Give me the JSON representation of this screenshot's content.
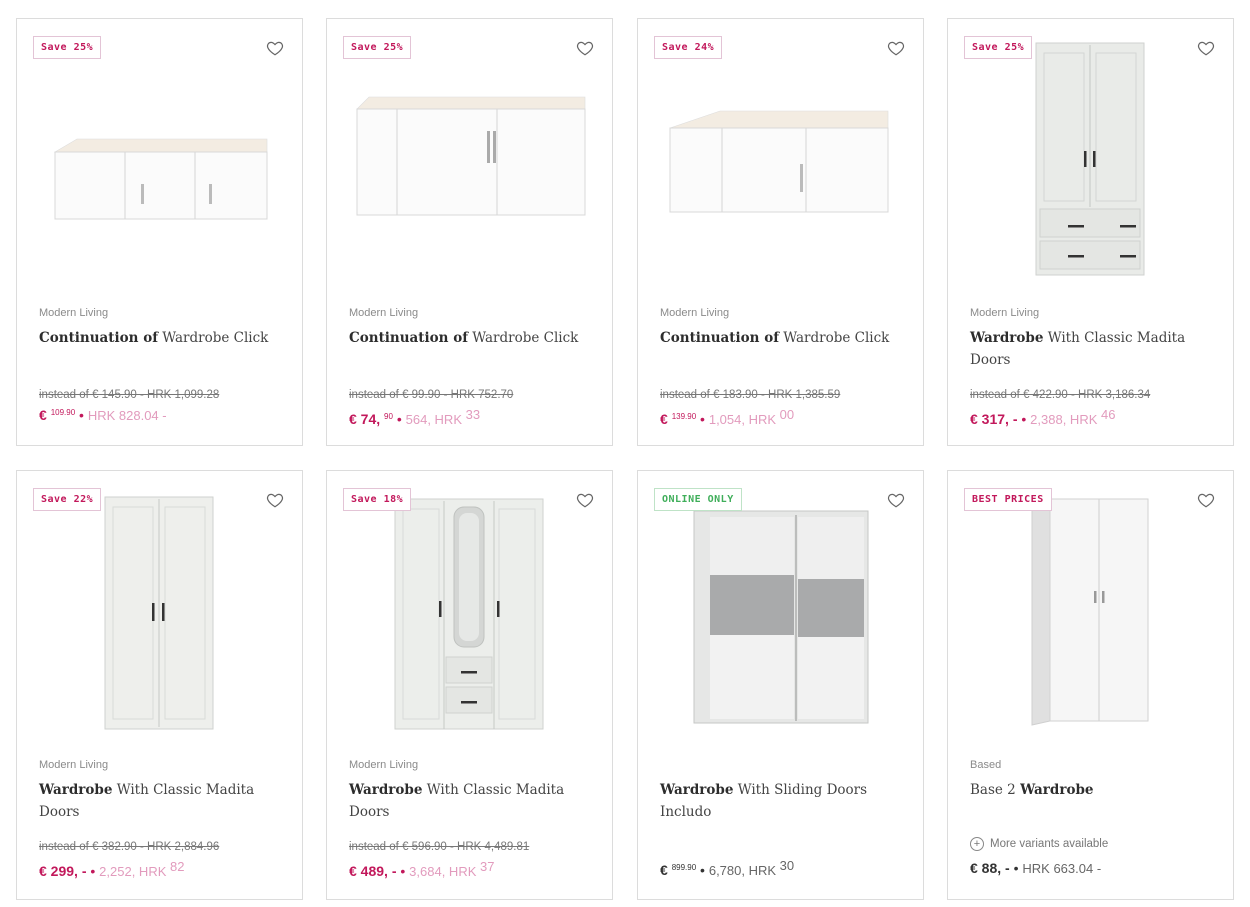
{
  "products": [
    {
      "badge": "Save 25%",
      "brand": "Modern Living",
      "title_bold": "Continuation of",
      "title_rest": " Wardrobe Click",
      "old_price": "instead of € 145.90 - HRK 1,099.28",
      "price_main": "€ ",
      "price_sup": "109.90",
      "price_sep": " • ",
      "price_conv": "HRK 828.04 -",
      "price_conv_sup": ""
    },
    {
      "badge": "Save 25%",
      "brand": "Modern Living",
      "title_bold": "Continuation of",
      "title_rest": " Wardrobe Click",
      "old_price": "instead of € 99.90 - HRK 752.70",
      "price_main": "€ 74, ",
      "price_sup": "90",
      "price_sep": " • ",
      "price_conv": "564, HRK ",
      "price_conv_sup": "33"
    },
    {
      "badge": "Save 24%",
      "brand": "Modern Living",
      "title_bold": "Continuation of",
      "title_rest": " Wardrobe Click",
      "old_price": "instead of € 183.90 - HRK 1,385.59",
      "price_main": "€ ",
      "price_sup": "139.90",
      "price_sep": " • ",
      "price_conv": "1,054, HRK ",
      "price_conv_sup": "00"
    },
    {
      "badge": "Save 25%",
      "brand": "Modern Living",
      "title_bold": "Wardrobe",
      "title_rest": " With Classic Madita Doors",
      "old_price": "instead of € 422.90 - HRK 3,186.34",
      "price_main": "€ 317, - ",
      "price_sup": "",
      "price_sep": "• ",
      "price_conv": "2,388, HRK ",
      "price_conv_sup": "46"
    },
    {
      "badge": "Save 22%",
      "brand": "Modern Living",
      "title_bold": "Wardrobe",
      "title_rest": " With Classic Madita Doors",
      "old_price": "instead of € 382.90 - HRK 2,884.96",
      "price_main": "€ 299, - ",
      "price_sup": "",
      "price_sep": "• ",
      "price_conv": "2,252, HRK ",
      "price_conv_sup": "82"
    },
    {
      "badge": "Save 18%",
      "brand": "Modern Living",
      "title_bold": "Wardrobe",
      "title_rest": " With Classic Madita Doors",
      "old_price": "instead of € 596.90 - HRK 4,489.81",
      "price_main": "€ 489, - ",
      "price_sup": "",
      "price_sep": "• ",
      "price_conv": "3,684, HRK ",
      "price_conv_sup": "37"
    },
    {
      "badge": "ONLINE ONLY",
      "brand": "",
      "title_bold": "Wardrobe",
      "title_rest": " With Sliding Doors Includo",
      "old_price": "",
      "price_main": "€ ",
      "price_sup": "899.90",
      "price_sep": " • ",
      "price_conv": "6,780, HRK ",
      "price_conv_sup": "30"
    },
    {
      "badge": "BEST PRICES",
      "brand": "Based",
      "title_plain": "Base 2 ",
      "title_bold": "Wardrobe",
      "variants": "More variants available",
      "price_main": "€ 88, - ",
      "price_sup": "",
      "price_sep": "• ",
      "price_conv": "HRK 663.04 -",
      "price_conv_sup": ""
    }
  ],
  "colors": {
    "accent": "#c2185b",
    "online": "#3fae5a",
    "border": "#dcdcdc"
  },
  "icons": {
    "wishlist": "heart-outline-icon",
    "variants": "plus-circle-icon"
  }
}
